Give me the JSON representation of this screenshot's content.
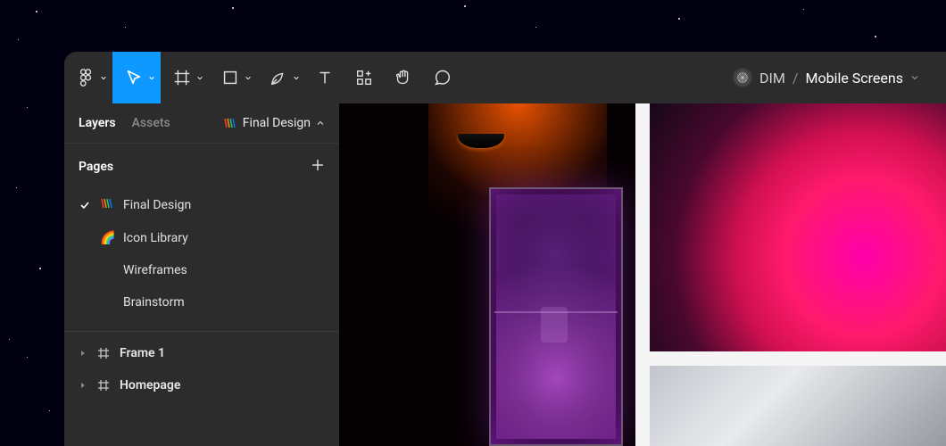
{
  "toolbar": {
    "project": "DIM",
    "separator": "/",
    "document": "Mobile Screens"
  },
  "sidebar": {
    "tabs": {
      "layers": "Layers",
      "assets": "Assets"
    },
    "page_dropdown": {
      "label": "Final Design"
    },
    "pages_header": "Pages",
    "pages": [
      {
        "emoji": "stripes",
        "label": "Final Design",
        "checked": true
      },
      {
        "emoji": "🌈",
        "label": "Icon Library",
        "checked": false
      },
      {
        "emoji": "",
        "label": "Wireframes",
        "checked": false
      },
      {
        "emoji": "",
        "label": "Brainstorm",
        "checked": false
      }
    ],
    "layers": [
      {
        "label": "Frame 1"
      },
      {
        "label": "Homepage"
      }
    ]
  }
}
